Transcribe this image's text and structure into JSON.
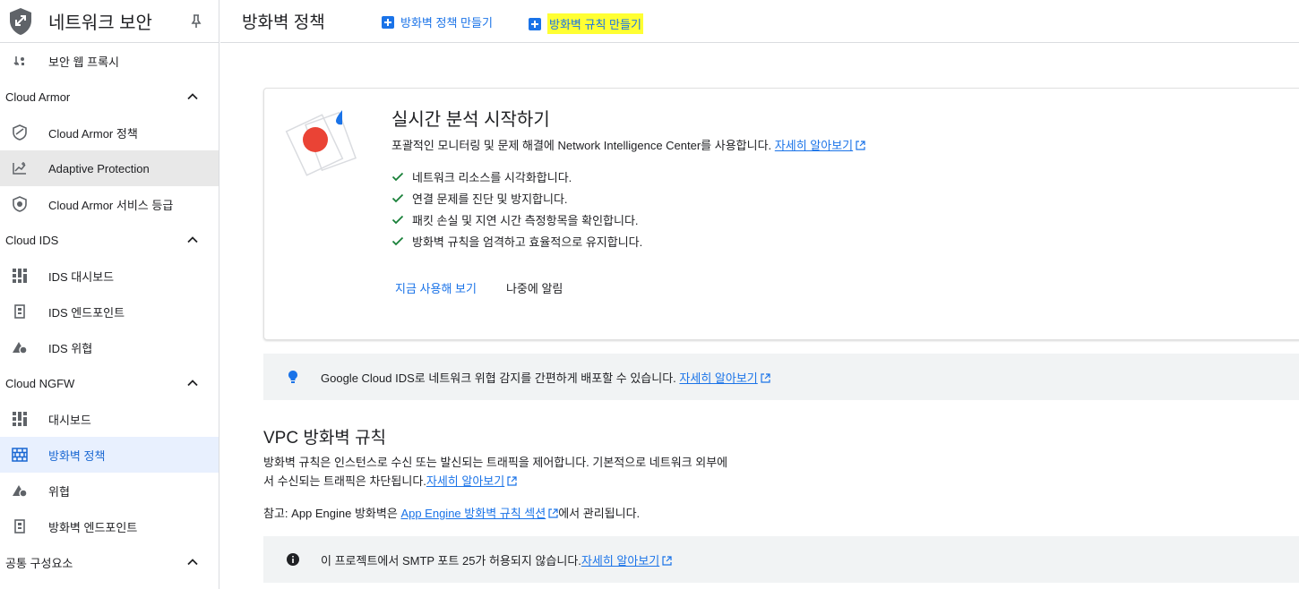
{
  "sidebar": {
    "title": "네트워크 보안",
    "items": [
      {
        "type": "item",
        "label": "보안 웹 프록시",
        "icon": "proxy-icon"
      },
      {
        "type": "section",
        "label": "Cloud Armor"
      },
      {
        "type": "item",
        "label": "Cloud Armor 정책",
        "icon": "shield-icon"
      },
      {
        "type": "item",
        "label": "Adaptive Protection",
        "icon": "chart-icon",
        "state": "hover"
      },
      {
        "type": "item",
        "label": "Cloud Armor 서비스 등급",
        "icon": "shield-badge-icon"
      },
      {
        "type": "section",
        "label": "Cloud IDS"
      },
      {
        "type": "item",
        "label": "IDS 대시보드",
        "icon": "dashboard-icon"
      },
      {
        "type": "item",
        "label": "IDS 엔드포인트",
        "icon": "endpoint-icon"
      },
      {
        "type": "item",
        "label": "IDS 위협",
        "icon": "threat-icon"
      },
      {
        "type": "section",
        "label": "Cloud NGFW"
      },
      {
        "type": "item",
        "label": "대시보드",
        "icon": "dashboard-icon"
      },
      {
        "type": "item",
        "label": "방화벽 정책",
        "icon": "firewall-icon",
        "state": "active"
      },
      {
        "type": "item",
        "label": "위협",
        "icon": "threat-icon"
      },
      {
        "type": "item",
        "label": "방화벽 엔드포인트",
        "icon": "endpoint-icon"
      },
      {
        "type": "section",
        "label": "공통 구성요소"
      }
    ]
  },
  "topbar": {
    "page_title": "방화벽 정책",
    "create_policy_label": "방화벽 정책 만들기",
    "create_rule_label": "방화벽 규칙 만들기"
  },
  "card": {
    "title": "실시간 분석 시작하기",
    "description": "포괄적인 모니터링 및 문제 해결에 Network Intelligence Center를 사용합니다.",
    "learn_more": "자세히 알아보기",
    "checks": [
      "네트워크 리소스를 시각화합니다.",
      "연결 문제를 진단 및 방지합니다.",
      "패킷 손실 및 지연 시간 측정항목을 확인합니다.",
      "방화벽 규칙을 엄격하고 효율적으로 유지합니다."
    ],
    "try_now": "지금 사용해 보기",
    "remind_later": "나중에 알림"
  },
  "ids_banner": {
    "text": "Google Cloud IDS로 네트워크 위협 감지를 간편하게 배포할 수 있습니다.",
    "learn_more": "자세히 알아보기"
  },
  "vpc": {
    "title": "VPC 방화벽 규칙",
    "description": "방화벽 규칙은 인스턴스로 수신 또는 발신되는 트래픽을 제어합니다. 기본적으로 네트워크 외부에서 수신되는 트래픽은 차단됩니다.",
    "learn_more": "자세히 알아보기",
    "note_prefix": "참고: App Engine 방화벽은 ",
    "note_link": "App Engine 방화벽 규칙 섹션",
    "note_suffix": "에서 관리됩니다."
  },
  "smtp_banner": {
    "text": "이 프로젝트에서 SMTP 포트 25가 허용되지 않습니다.",
    "learn_more": "자세히 알아보기"
  },
  "colors": {
    "accent": "#1a73e8",
    "highlight": "#ffff33",
    "check": "#188038",
    "active_bg": "#e8f0fe"
  }
}
